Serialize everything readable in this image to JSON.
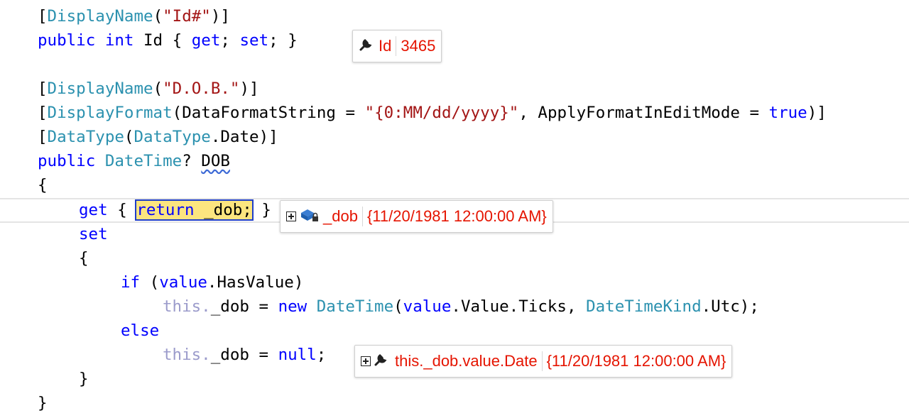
{
  "code": {
    "l1": {
      "open": "[",
      "attr": "DisplayName",
      "p1": "(",
      "str": "\"Id#\"",
      "p2": ")]"
    },
    "l2": {
      "kw1": "public",
      "kw2": "int",
      "name": "Id",
      "ob": "{",
      "get": "get",
      "semi1": ";",
      "set": "set",
      "semi2": ";",
      "cb": "}"
    },
    "l4": {
      "open": "[",
      "attr": "DisplayName",
      "p1": "(",
      "str": "\"D.O.B.\"",
      "p2": ")]"
    },
    "l5": {
      "open": "[",
      "attr": "DisplayFormat",
      "p1": "(DataFormatString = ",
      "str": "\"{0:MM/dd/yyyy}\"",
      "p2": ", ApplyFormatInEditMode = ",
      "val": "true",
      "p3": ")]"
    },
    "l6": {
      "open": "[",
      "attr": "DataType",
      "p1": "(",
      "type": "DataType",
      "p2": ".Date)]"
    },
    "l7": {
      "kw": "public",
      "type": "DateTime",
      "q": "?",
      "name": "DOB"
    },
    "l8": {
      "brace": "{"
    },
    "l9": {
      "get": "get",
      "ob": "{",
      "kw": "return",
      "rest": " _dob;",
      "tail": " }"
    },
    "l10": {
      "set": "set"
    },
    "l11": {
      "brace": "{"
    },
    "l12": {
      "kw": "if",
      "p1": " (",
      "val": "value",
      "p2": ".HasValue)"
    },
    "l13": {
      "th": "this.",
      "p1": "_dob = ",
      "new": "new",
      "type": "DateTime",
      "p2": "(",
      "val": "value",
      "p3": ".Value.Ticks, ",
      "type2": "DateTimeKind",
      "p4": ".Utc);"
    },
    "l14": {
      "kw": "else"
    },
    "l15": {
      "th": "this.",
      "p1": "_dob = ",
      "kw": "null",
      "p2": ";"
    },
    "l16": {
      "brace": "}"
    },
    "l17": {
      "brace": "}"
    }
  },
  "datatips": {
    "id": {
      "name": "Id",
      "value": "3465",
      "icon": "wrench-icon"
    },
    "dob": {
      "name": "_dob",
      "value": "{11/20/1981 12:00:00 AM}",
      "icon": "private-field-icon"
    },
    "date": {
      "name": "this._dob.value.Date",
      "value": "{11/20/1981 12:00:00 AM}",
      "icon": "wrench-icon"
    }
  },
  "colors": {
    "keyword": "#0000ff",
    "type": "#2b91af",
    "string": "#a31515",
    "datatip_text": "#e51400",
    "highlight": "#fce57f"
  }
}
